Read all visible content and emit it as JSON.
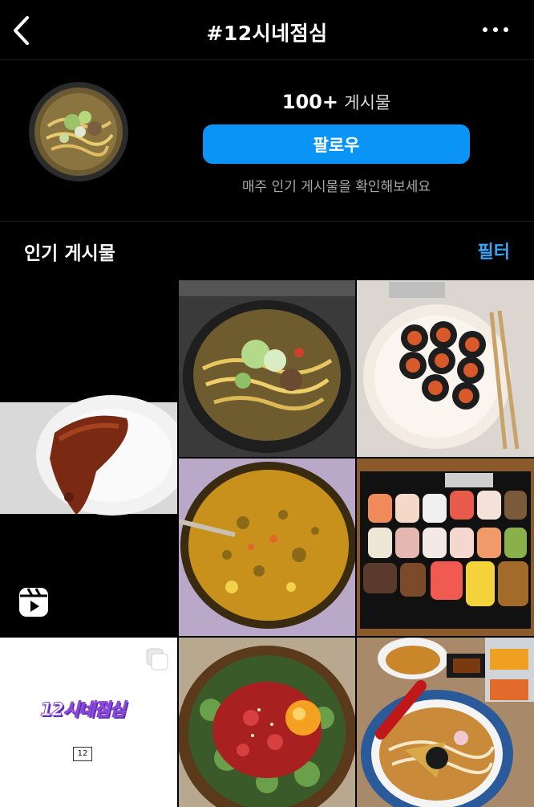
{
  "header": {
    "title": "#12시네점심",
    "back_icon": "chevron-left-icon",
    "more_icon": "more-horizontal-icon"
  },
  "profile": {
    "post_count": "100+",
    "post_label": "게시물",
    "follow_label": "팔로우",
    "subtitle": "매주 인기 게시물을 확인해보세요"
  },
  "section": {
    "title": "인기 게시물",
    "filter_label": "필터"
  },
  "grid": {
    "reel_icon": "reels-icon",
    "carousel_icon": "multiple-photos-icon",
    "logo_text": "12시네점심",
    "badge_text": "12"
  },
  "colors": {
    "background": "#000000",
    "accent": "#0a95f6",
    "filter_link": "#3ba4f7",
    "subtext": "#a8a8a8"
  }
}
